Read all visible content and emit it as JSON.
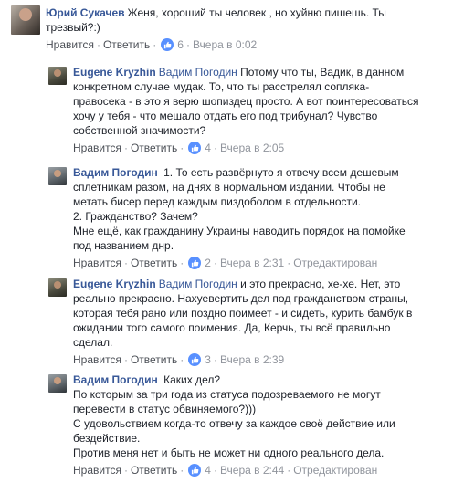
{
  "colors": {
    "link": "#385898",
    "like_badge": "#5890ff",
    "meta": "#90949c"
  },
  "actions": {
    "like": "Нравится",
    "reply": "Ответить",
    "separator": "·"
  },
  "comments": [
    {
      "author": "Юрий Сукачев",
      "lines": [
        "Женя, хороший ты человек , но хуйню пишешь. Ты",
        "трезвый?:)"
      ],
      "likes": "6",
      "time": "Вчера в 0:02",
      "edited": ""
    },
    {
      "author": "Eugene Kryzhin",
      "mention": "Вадим Погодин",
      "lines": [
        "Потому что ты, Вадик, в данном",
        "конкретном случае мудак. То, что ты расстрелял сопляка-",
        "правосека - в это я верю шопиздец просто. А вот поинтересоваться",
        "хочу у тебя - что мешало отдать его под трибунал? Чувство",
        "собственной значимости?"
      ],
      "likes": "4",
      "time": "Вчера в 2:05",
      "edited": ""
    },
    {
      "author": "Вадим Погодин",
      "lines": [
        "1. То есть развёрнуто я отвечу всем дешевым",
        "сплетникам разом, на днях в нормальном издании. Чтобы не",
        "метать бисер перед каждым пиздоболом в отдельности.",
        "2. Гражданство? Зачем?",
        "Мне ещё, как гражданину Украины наводить порядок на помойке",
        "под названием днр."
      ],
      "likes": "2",
      "time": "Вчера в 2:31",
      "edited": "Отредактирован"
    },
    {
      "author": "Eugene Kryzhin",
      "mention": "Вадим Погодин",
      "lines": [
        "и это прекрасно, хе-хе. Нет, это",
        "реально прекрасно. Нахуевертить дел под гражданством страны,",
        "которая тебя рано или поздно поимеет - и сидеть, курить бамбук в",
        "ожидании того самого поимения. Да, Керчь, ты всё правильно",
        "сделал."
      ],
      "likes": "3",
      "time": "Вчера в 2:39",
      "edited": ""
    },
    {
      "author": "Вадим Погодин",
      "lines": [
        "Каких дел?",
        "По которым за три года из статуса подозреваемого не могут",
        "перевести в статус обвиняемого?)))",
        "С удовольствием когда-то отвечу за каждое своё действие или",
        "бездействие.",
        "Против меня нет и быть не может ни одного реального дела."
      ],
      "likes": "4",
      "time": "Вчера в 2:44",
      "edited": "Отредактирован"
    }
  ]
}
